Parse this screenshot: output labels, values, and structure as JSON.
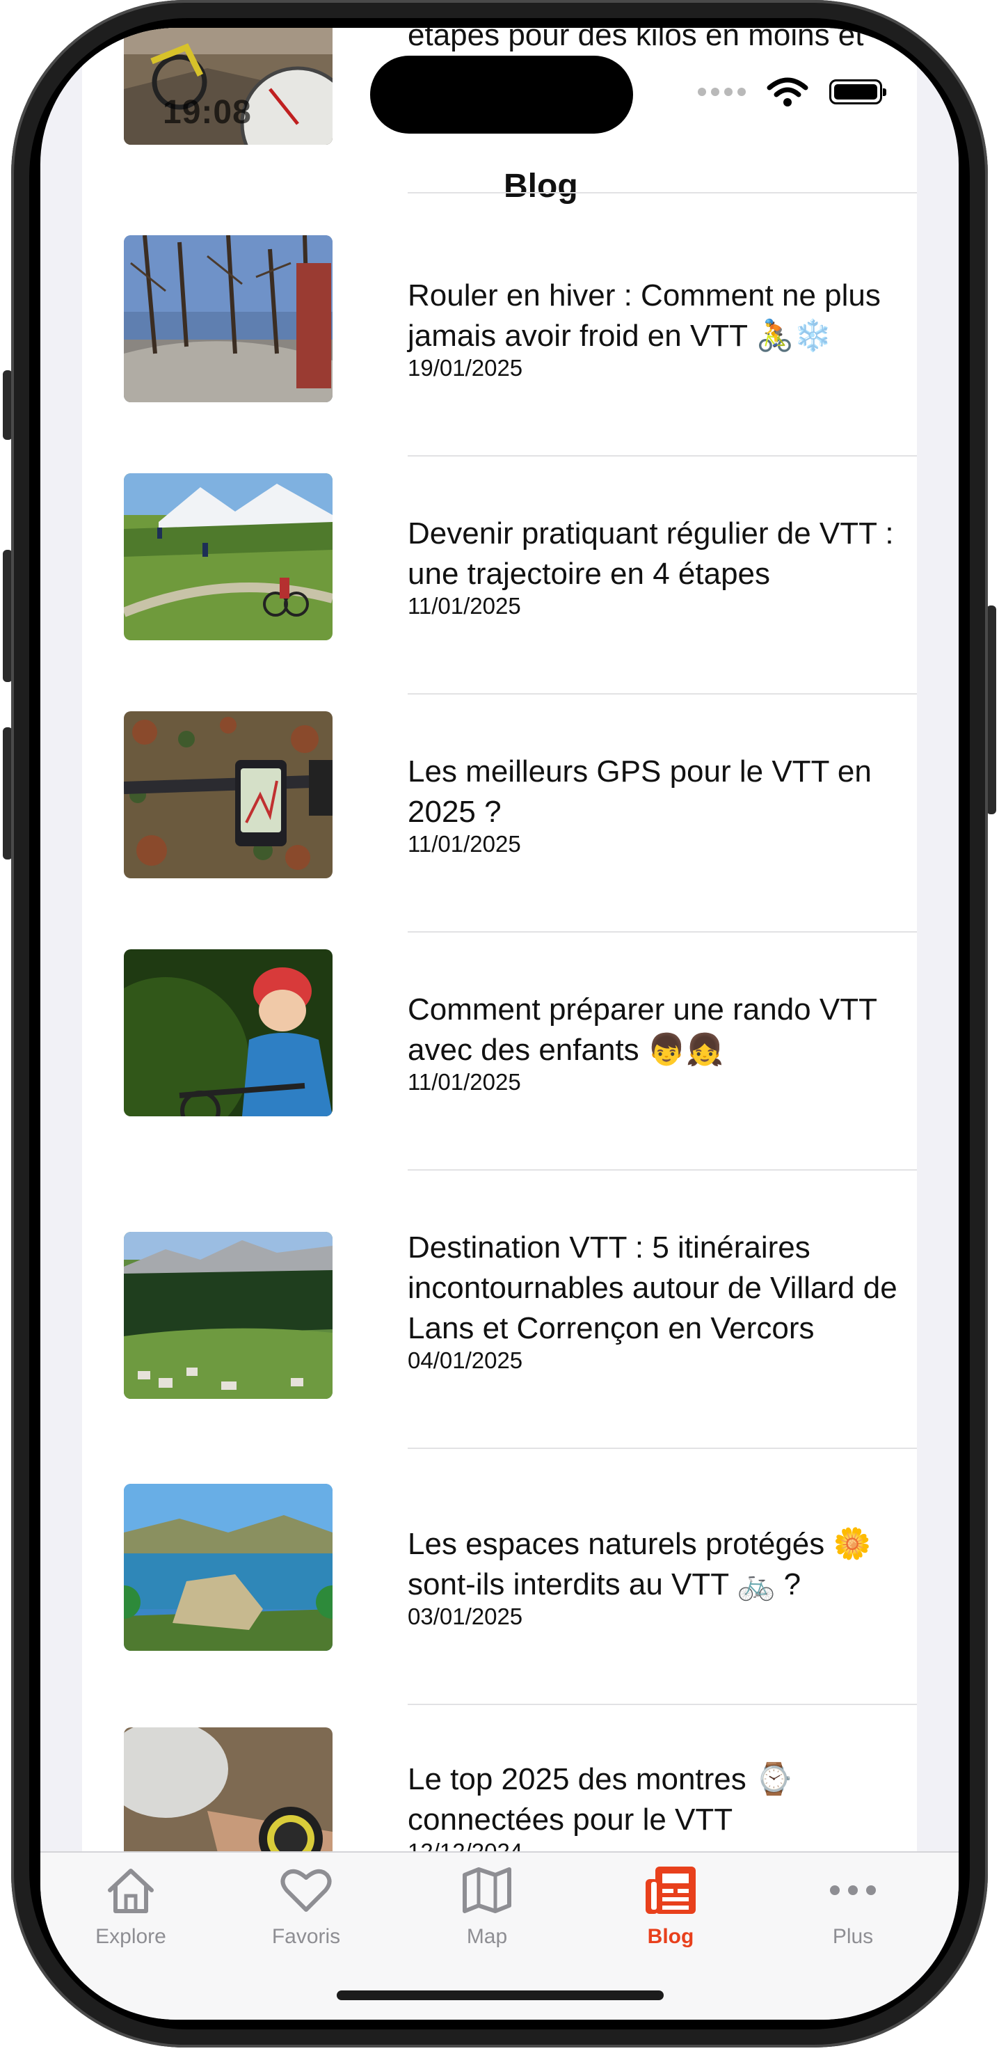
{
  "status_bar": {
    "time": "19:08"
  },
  "nav": {
    "title": "Blog"
  },
  "top_partial": {
    "title_visible": "étapes pour des kilos en moins et",
    "title_hidden": "…🚵🔥"
  },
  "articles": [
    {
      "title": "Rouler en hiver : Comment ne plus jamais avoir froid en VTT 🚴❄️",
      "date": "19/01/2025",
      "thumbnail": "winter-forest-trail"
    },
    {
      "title": "Devenir pratiquant régulier de VTT : une trajectoire en 4 étapes",
      "date": "11/01/2025",
      "thumbnail": "alpine-meadow-riders"
    },
    {
      "title": "Les meilleurs GPS pour le VTT en 2025 ?",
      "date": "11/01/2025",
      "thumbnail": "handlebar-gps"
    },
    {
      "title": "Comment préparer une rando VTT avec des enfants 👦👧",
      "date": "11/01/2025",
      "thumbnail": "child-helmet-bike"
    },
    {
      "title": "Destination VTT : 5 itinéraires incontournables autour de Villard de Lans et Corrençon en Vercors",
      "date": "04/01/2025",
      "thumbnail": "vercors-valley"
    },
    {
      "title": "Les espaces naturels protégés 🌼 sont-ils interdits au VTT 🚲 ?",
      "date": "03/01/2025",
      "thumbnail": "mountain-lake-rock"
    },
    {
      "title": "Le top 2025 des montres ⌚ connectées pour le VTT",
      "date": "12/12/2024",
      "thumbnail": "sport-watch-wrist"
    }
  ],
  "tabbar": {
    "items": [
      {
        "label": "Explore",
        "icon": "house-icon",
        "active": false
      },
      {
        "label": "Favoris",
        "icon": "heart-icon",
        "active": false
      },
      {
        "label": "Map",
        "icon": "map-icon",
        "active": false
      },
      {
        "label": "Blog",
        "icon": "newspaper-icon",
        "active": true
      },
      {
        "label": "Plus",
        "icon": "ellipsis-icon",
        "active": false
      }
    ]
  },
  "colors": {
    "accent": "#e8401c",
    "inactive": "#8e8e93",
    "background": "#f1f1f6"
  }
}
